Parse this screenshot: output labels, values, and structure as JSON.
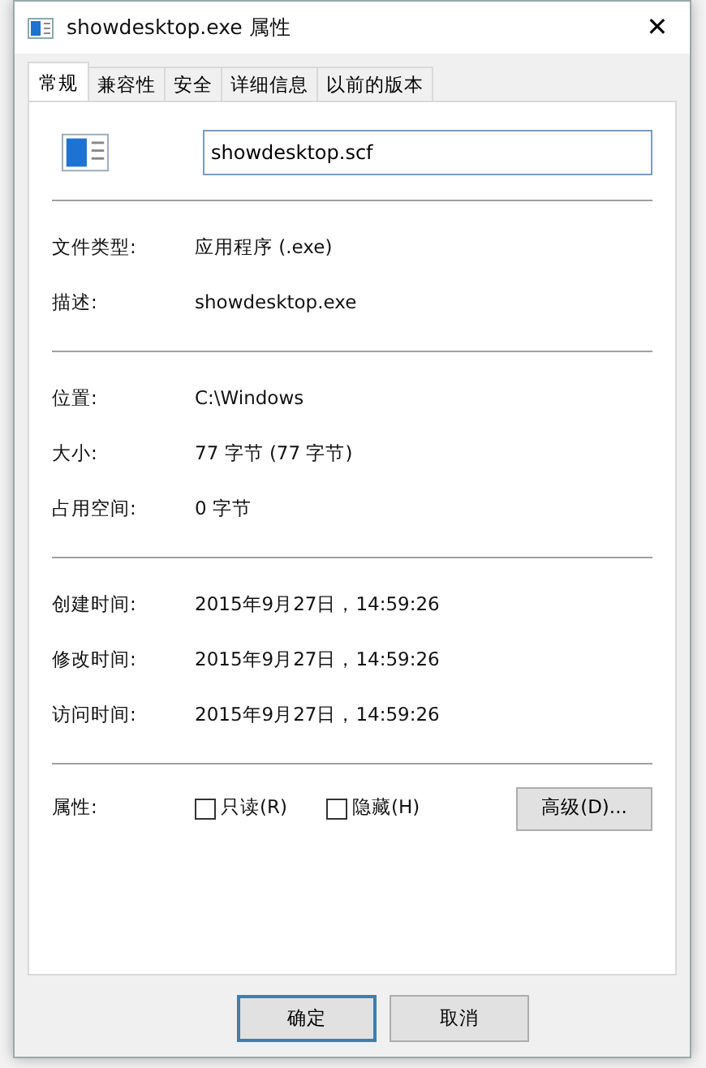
{
  "window": {
    "title": "showdesktop.exe 属性",
    "close": "✕"
  },
  "tabs": [
    {
      "label": "常规",
      "selected": true
    },
    {
      "label": "兼容性",
      "selected": false
    },
    {
      "label": "安全",
      "selected": false
    },
    {
      "label": "详细信息",
      "selected": false
    },
    {
      "label": "以前的版本",
      "selected": false
    }
  ],
  "file_name": "showdesktop.scf",
  "sections": [
    [
      {
        "label": "文件类型:",
        "value": "应用程序 (.exe)"
      },
      {
        "label": "描述:",
        "value": "showdesktop.exe"
      }
    ],
    [
      {
        "label": "位置:",
        "value": "C:\\Windows"
      },
      {
        "label": "大小:",
        "value": "77 字节 (77 字节)"
      },
      {
        "label": "占用空间:",
        "value": "0 字节"
      }
    ],
    [
      {
        "label": "创建时间:",
        "value": "2015年9月27日，14:59:26"
      },
      {
        "label": "修改时间:",
        "value": "2015年9月27日，14:59:26"
      },
      {
        "label": "访问时间:",
        "value": "2015年9月27日，14:59:26"
      }
    ]
  ],
  "attributes": {
    "label": "属性:",
    "checkboxes": [
      {
        "label": "只读(R)",
        "checked": false
      },
      {
        "label": "隐藏(H)",
        "checked": false
      }
    ],
    "advanced": "高级(D)..."
  },
  "buttons": [
    {
      "label": "确定",
      "default": true
    },
    {
      "label": "取消",
      "default": false
    }
  ]
}
